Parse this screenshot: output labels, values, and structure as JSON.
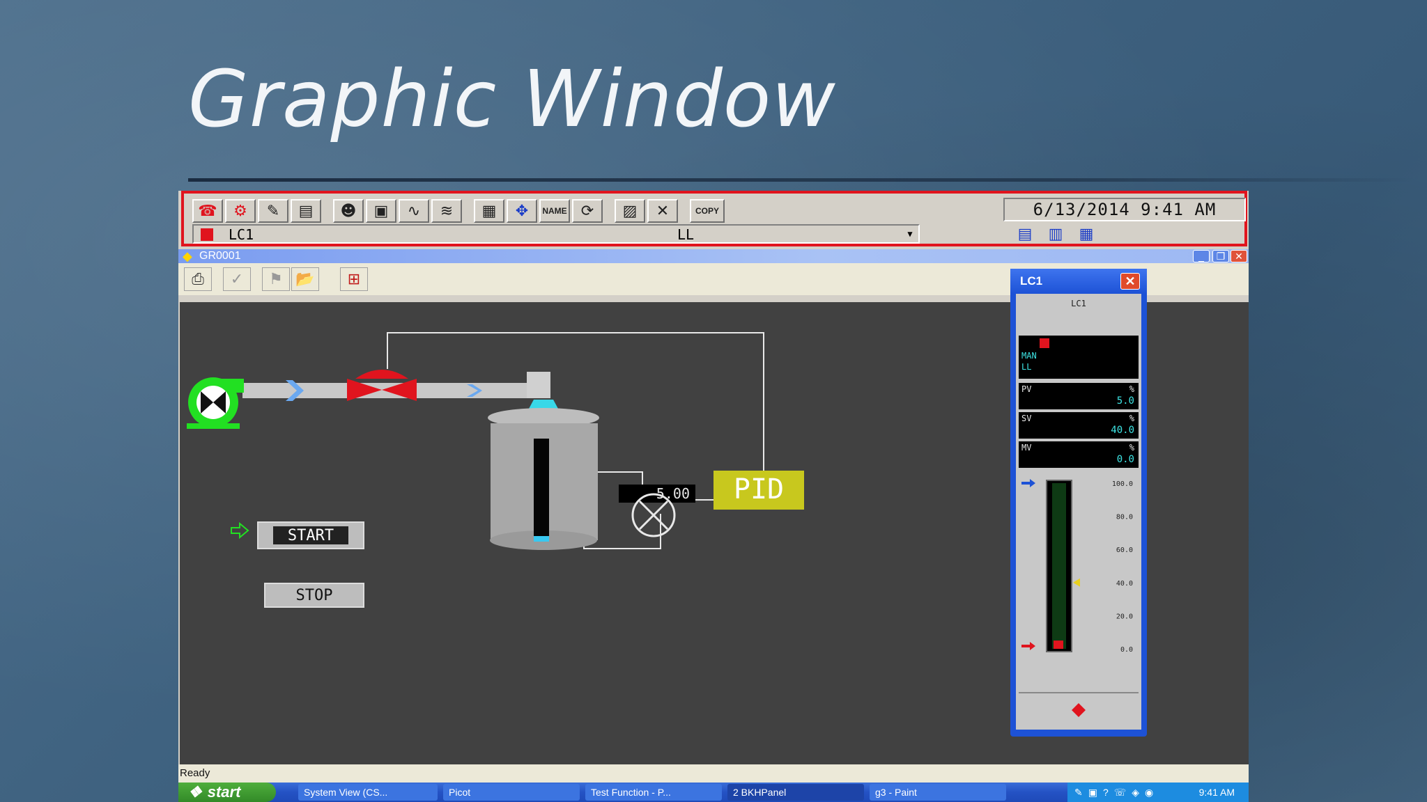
{
  "slide": {
    "title": "Graphic Window"
  },
  "toolbar": {
    "datetime": "6/13/2014 9:41 AM",
    "name_label": "NAME",
    "copy_label": "COPY",
    "tag": "LC1",
    "status": "LL"
  },
  "window": {
    "title": "GR0001"
  },
  "process": {
    "value_display": "5.00",
    "pid_label": "PID",
    "start_label": "START",
    "stop_label": "STOP"
  },
  "faceplate": {
    "title": "LC1",
    "tag": "LC1",
    "mode": "MAN",
    "alarm": "LL",
    "pv": {
      "label": "PV",
      "unit": "%",
      "value": "5.0"
    },
    "sv": {
      "label": "SV",
      "unit": "%",
      "value": "40.0"
    },
    "mv": {
      "label": "MV",
      "unit": "%",
      "value": "0.0"
    },
    "scale": [
      "100.0",
      "80.0",
      "60.0",
      "40.0",
      "20.0",
      "0.0"
    ],
    "pv_level": 0.05,
    "sv_level": 0.4
  },
  "status_bar": {
    "text": "Ready"
  },
  "taskbar": {
    "start_label": "start",
    "tasks": [
      "System View (CS...",
      "Picot",
      "Test Function - P...",
      "2 BKHPanel",
      "g3 - Paint"
    ],
    "clock": "9:41 AM"
  },
  "colors": {
    "alarm_red": "#e0141e",
    "pump_green": "#22e022",
    "pid_yellow": "#c8c81e",
    "xp_blue": "#2452c4"
  }
}
